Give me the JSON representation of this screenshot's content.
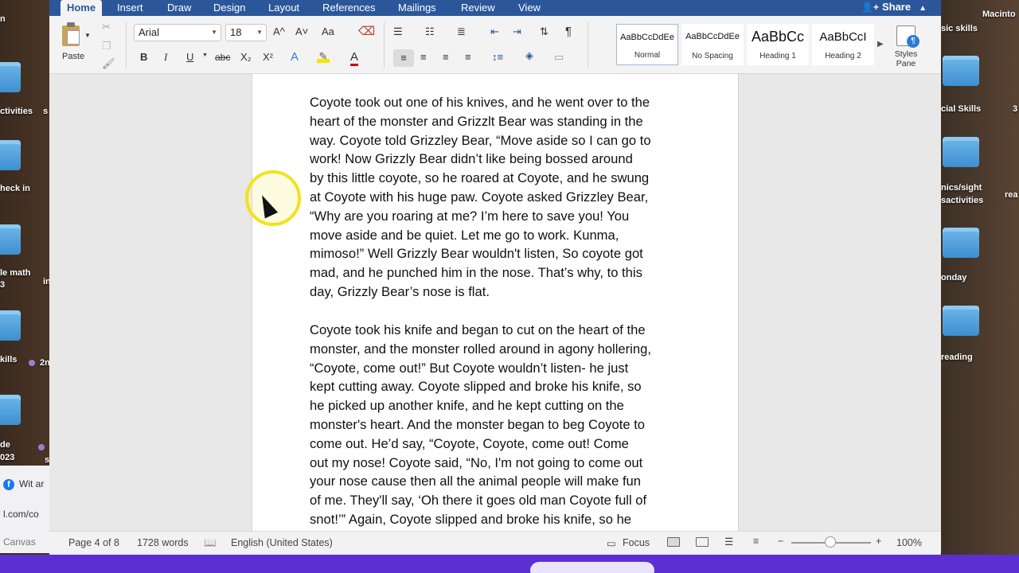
{
  "desktop": {
    "left_labels": [
      "n",
      "ctivities",
      "s",
      "heck in",
      "le math",
      "3",
      "in",
      "kills",
      "2n",
      "de",
      "023",
      "s"
    ],
    "right_labels": [
      "Macinto",
      "sic skills",
      "cial Skills",
      "3",
      "nics/sight",
      "sactivities",
      "rea",
      "onday",
      "reading"
    ],
    "browser": {
      "facebook_icon": "facebook-icon",
      "facebook_text": "Wit ar",
      "url_text": "l.com/co",
      "canvas_text": "Canvas"
    },
    "bottom_bar": {
      "color": "#5b2fd0"
    }
  },
  "word": {
    "tabs": [
      "Home",
      "Insert",
      "Draw",
      "Design",
      "Layout",
      "References",
      "Mailings",
      "Review",
      "View"
    ],
    "active_tab": "Home",
    "share_label": "Share",
    "brand_color": "#2b579a",
    "clipboard": {
      "paste_label": "Paste"
    },
    "font": {
      "name": "Arial",
      "size": "18"
    },
    "format_buttons": {
      "bold": "B",
      "italic": "I",
      "underline": "U",
      "strike": "abc",
      "subscript": "X₂",
      "superscript": "X²",
      "text_effects": "A",
      "font_color": "A",
      "grow": "A^",
      "shrink": "A˅",
      "aa": "Aa",
      "pilcrow": "¶"
    },
    "styles": [
      {
        "sample": "AaBbCcDdEe",
        "name": "Normal"
      },
      {
        "sample": "AaBbCcDdEe",
        "name": "No Spacing"
      },
      {
        "sample": "AaBbCc",
        "name": "Heading 1"
      },
      {
        "sample": "AaBbCcI",
        "name": "Heading 2"
      }
    ],
    "styles_pane_label": "Styles\nPane",
    "document": {
      "paragraphs": [
        "Coyote took out one of his knives, and he went over to the\nheart of the monster and Grizzlt Bear was standing in the\nway. Coyote told Grizzley Bear, “Move aside so I can go to\nwork!  Now Grizzly Bear didn’t like being bossed around\nby this little coyote, so he roared at Coyote, and he swung\nat Coyote with his huge paw. Coyote asked Grizzley Bear,\n“Why are you roaring at me? I’m here to save you! You\nmove aside and be quiet. Let me go to work. Kunma,\nmimoso!” Well Grizzly Bear wouldn't listen, So coyote got\nmad, and he punched him in the nose. That’s why, to this\nday, Grizzly Bear’s nose is flat.",
        "Coyote took his knife and began to cut on the heart of the\nmonster, and the monster rolled around in agony hollering,\n“Coyote, come out!” But Coyote wouldn’t listen- he just\nkept cutting away. Coyote slipped and broke his knife, so\nhe picked up another knife, and he kept cutting on the\nmonster's heart. And the monster began to beg Coyote to\ncome out.  He’d say, “Coyote, Coyote, come out! Come\nout my nose! Coyote said, “No, I'm not going to come out\nyour nose cause then all the animal people will make fun\nof me. They'll say, ‘Oh there it goes old man Coyote full of\nsnot!’” Again, Coyote slipped and broke his knife, so he"
      ]
    },
    "status": {
      "page": "Page 4 of 8",
      "words": "1728 words",
      "language": "English (United States)",
      "focus": "Focus",
      "zoom_minus": "−",
      "zoom_plus": "+",
      "zoom": "100%",
      "zoom_level": 1.0
    }
  }
}
